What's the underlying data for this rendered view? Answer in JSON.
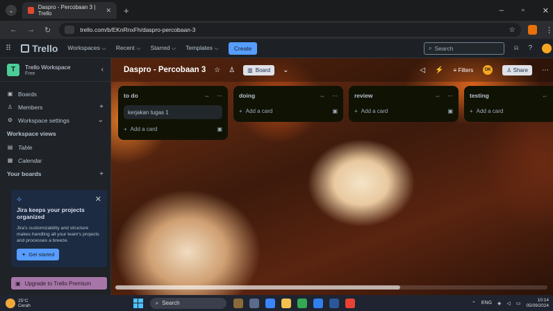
{
  "browser": {
    "tab_title": "Daspro - Percobaan 3 | Trello",
    "tab_close": "✕",
    "new_tab": "+",
    "url": "trello.com/b/EKnRnxFh/daspro-percobaan-3"
  },
  "header": {
    "logo": "Trello",
    "menus": [
      "Workspaces ⌵",
      "Recent ⌵",
      "Starred ⌵",
      "Templates ⌵"
    ],
    "create_label": "Create",
    "search_placeholder": "Search"
  },
  "sidebar": {
    "workspace_initial": "T",
    "workspace_name": "Trello Workspace",
    "workspace_plan": "Free",
    "items": [
      {
        "label": "Boards",
        "icon": "board-icon"
      },
      {
        "label": "Members",
        "icon": "members-icon"
      },
      {
        "label": "Workspace settings",
        "icon": "settings-icon"
      }
    ],
    "views_heading": "Workspace views",
    "views": [
      {
        "label": "Table",
        "icon": "table-icon"
      },
      {
        "label": "Calendar",
        "icon": "calendar-icon"
      }
    ],
    "your_boards": "Your boards",
    "jira": {
      "title": "Jira keeps your projects organized",
      "desc": "Jira's customizability and structure makes handling all your team's projects and processes a breeze.",
      "cta": "Get started"
    },
    "upgrade": "Upgrade to Trello Premium"
  },
  "board": {
    "title": "Daspro - Percobaan 3",
    "view": "Board",
    "filters": "Filters",
    "avatar": "OK",
    "share": "Share",
    "lists": [
      {
        "title": "to do",
        "cards": [
          "kerjakan tugas 1"
        ],
        "add": "Add a card"
      },
      {
        "title": "doing",
        "cards": [],
        "add": "Add a card"
      },
      {
        "title": "review",
        "cards": [],
        "add": "Add a card"
      },
      {
        "title": "testing",
        "cards": [],
        "add": "Add a card"
      }
    ]
  },
  "taskbar": {
    "temp": "25°C",
    "weather": "Cerah",
    "search": "Search",
    "lang": "ENG",
    "time": "10:14",
    "date": "05/09/2024"
  },
  "colors": {
    "accent": "#579dff",
    "list_bg": "#101204",
    "workspace_badge": "#4bce97"
  }
}
